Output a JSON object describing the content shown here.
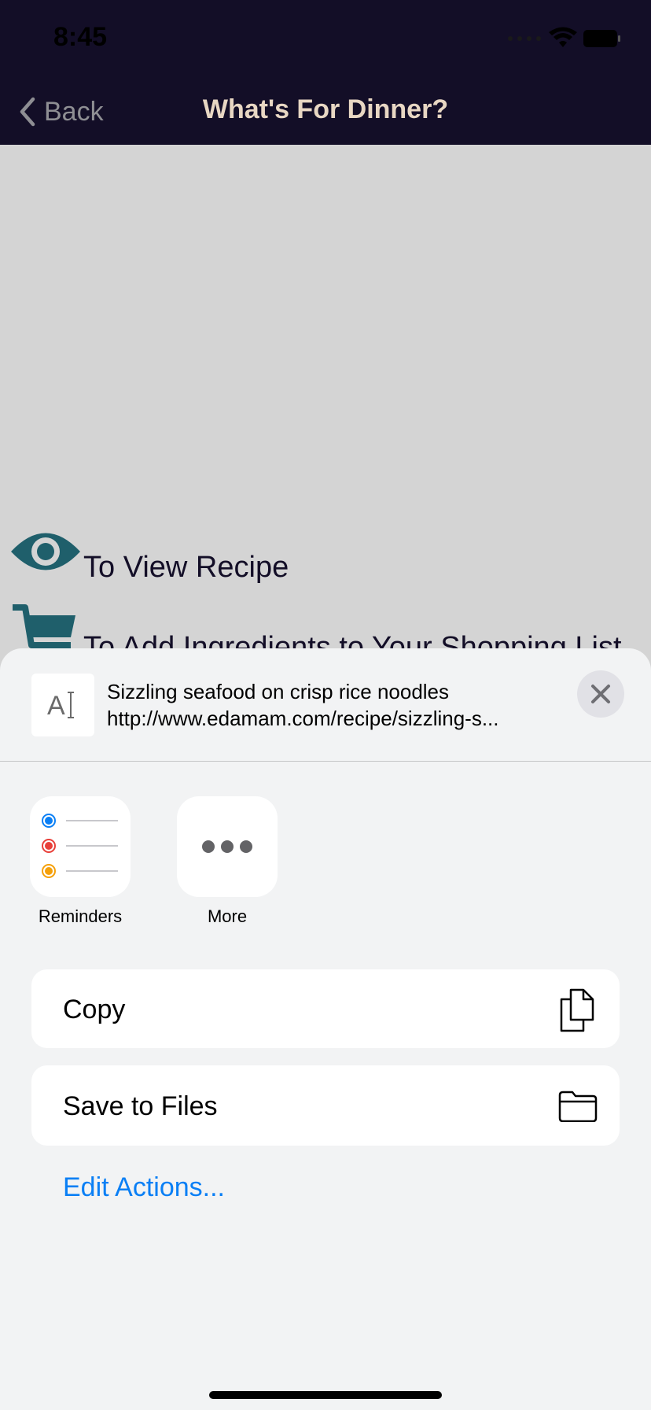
{
  "status_bar": {
    "time": "8:45"
  },
  "nav": {
    "back_label": "Back",
    "title": "What's For Dinner?"
  },
  "content": {
    "view_recipe_label": "To View Recipe",
    "add_ingredients_label": "To Add Ingredients to Your Shopping List"
  },
  "share_sheet": {
    "title": "Sizzling seafood on crisp rice noodles",
    "url": "http://www.edamam.com/recipe/sizzling-s...",
    "apps": [
      {
        "label": "Reminders",
        "icon": "reminders-icon"
      },
      {
        "label": "More",
        "icon": "more-icon"
      }
    ],
    "actions": [
      {
        "label": "Copy",
        "icon": "copy-icon"
      },
      {
        "label": "Save to Files",
        "icon": "folder-icon"
      }
    ],
    "edit_actions_label": "Edit Actions..."
  },
  "colors": {
    "nav_background": "#130e27",
    "nav_title": "#e8d7c3",
    "accent_teal": "#1f5f6b",
    "link_blue": "#0a7ff5",
    "sheet_background": "#f2f3f4"
  }
}
